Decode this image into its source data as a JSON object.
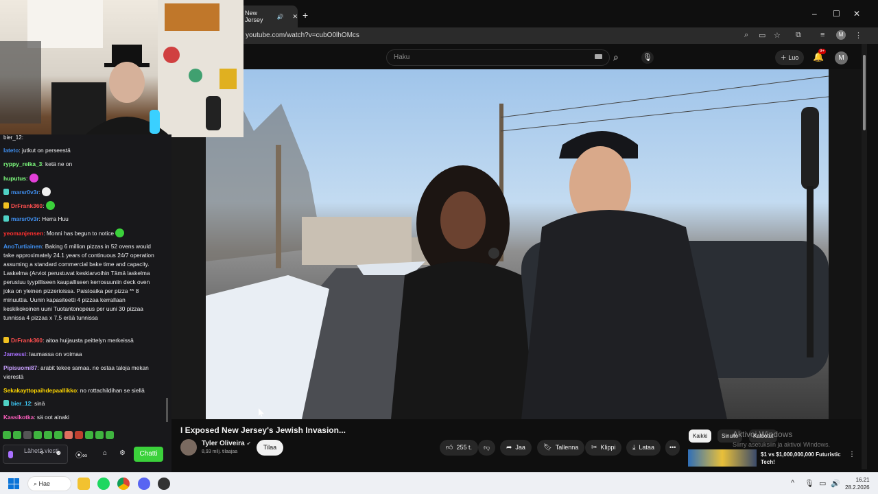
{
  "browser": {
    "tab_title": "New Jersey",
    "new_tab": "+",
    "url": "youtube.com/watch?v=cubO0lhOMcs",
    "profile_initial": "M",
    "window_controls": [
      "–",
      "☐",
      "✕"
    ]
  },
  "youtube": {
    "search_placeholder": "Haku",
    "create_label": "Luo",
    "notifications_badge": "9+",
    "avatar_initial": "M",
    "video_title": "I Exposed New Jersey's Jewish Invasion...",
    "channel_name": "Tyler Oliveira",
    "channel_subs": "8,93 milj. tilaajaa",
    "subscribe_label": "Tilaa",
    "like_count": "255 t.",
    "share_label": "Jaa",
    "save_label": "Tallenna",
    "clip_label": "Klippi",
    "download_label": "Lataa",
    "more_label": "•••",
    "chips": [
      "Kaikki",
      "Sinulle",
      "Katsotut"
    ],
    "activate_title": "Aktivoi Windows",
    "activate_sub": "Siirry asetuksiin ja aktivoi Windows.",
    "rec_title": "$1 vs $1,000,000,000 Futuristic Tech!"
  },
  "chat": {
    "messages": [
      {
        "user": "lateto",
        "color": "#3f8ff0",
        "text": "jutkut on perseestä"
      },
      {
        "user": "ryppy_reika_3",
        "color": "#7fff7f",
        "text": "ketä ne on"
      },
      {
        "user": "huputus",
        "color": "#7fff7f",
        "text": ""
      },
      {
        "user": "marsr0v3r",
        "color": "#3f8ff0",
        "text": ""
      },
      {
        "user": "DrFrank360",
        "color": "#ff4f4f",
        "text": ""
      },
      {
        "user": "marsr0v3r",
        "color": "#3f8ff0",
        "text": "Herra Huu"
      },
      {
        "user": "yeomanjensen",
        "color": "#ff2f2f",
        "text": "Monni has begun to notice"
      },
      {
        "user": "AnoTurtiainen",
        "color": "#3f8ff0",
        "text": "Baking 6 million pizzas in 52 ovens would take approximately 24.1 years of continuous 24/7 operation assuming a standard commercial bake time and capacity. Laskelma (Arviot perustuvat keskiarvoihin Tämä laskelma perustuu tyypilliseen kaupalliseen kerrosuuniin deck oven joka on yleinen pizzerioissa. Paistoaika per pizza ** 8 minuuttia. Uunin kapasiteetti 4 pizzaa kerrallaan keskikokoinen uuni Tuotantonopeus per uuni 30 pizzaa tunnissa 4 pizzaa x 7,5 erää tunnissa"
      },
      {
        "user": "DrFrank360",
        "color": "#ff4f4f",
        "text": "aitoa huijausta peittelyn merkeissä"
      },
      {
        "user": "Jamessi",
        "color": "#a970ff",
        "text": "laumassa on voimaa"
      },
      {
        "user": "Pipisuomi87",
        "color": "#c8a0ff",
        "text": "arabit tekee samaa. ne ostaa taloja mekan vierestä"
      },
      {
        "user": "Sekakayttopaihdepaallikko",
        "color": "#ffd700",
        "text": "no rottachildihan se siellä"
      },
      {
        "user": "bier_12",
        "color": "#3fd0ff",
        "text": "sinä"
      },
      {
        "user": "Kassikotka",
        "color": "#ff5fbf",
        "text": "sä oot ainaki"
      }
    ],
    "input_placeholder": "Lähetä viesti",
    "send_label": "Chatti"
  },
  "taskbar": {
    "search_label": "Hae",
    "time": "16.21",
    "date": "28.2.2026"
  }
}
